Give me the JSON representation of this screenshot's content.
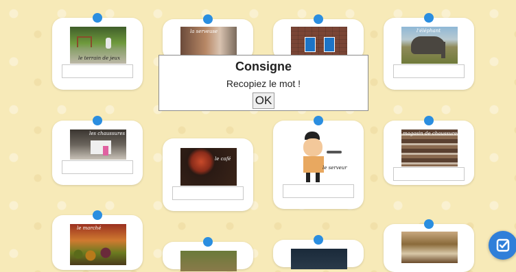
{
  "cards": [
    {
      "id": "terrain",
      "caption": "le terrain de jeux",
      "answer": ""
    },
    {
      "id": "serveuse",
      "caption": "la serveuse",
      "answer": ""
    },
    {
      "id": "toilettes",
      "caption": "",
      "answer": ""
    },
    {
      "id": "elephant",
      "caption": "l'éléphant",
      "answer": ""
    },
    {
      "id": "chaussures",
      "caption": "les chaussures",
      "answer": ""
    },
    {
      "id": "cafe",
      "caption": "le café",
      "answer": ""
    },
    {
      "id": "serveur",
      "caption": "le serveur",
      "answer": ""
    },
    {
      "id": "magasin",
      "caption": "magasin de chaussures",
      "answer": ""
    },
    {
      "id": "marche",
      "caption": "le marché",
      "answer": ""
    }
  ],
  "dialog": {
    "title": "Consigne",
    "message": "Recopiez le mot !",
    "ok_label": "OK"
  },
  "icons": {
    "check_button": "check-icon"
  },
  "colors": {
    "pin": "#2b8ee0",
    "background": "#f7eab8",
    "check_button": "#2f7fd9"
  }
}
